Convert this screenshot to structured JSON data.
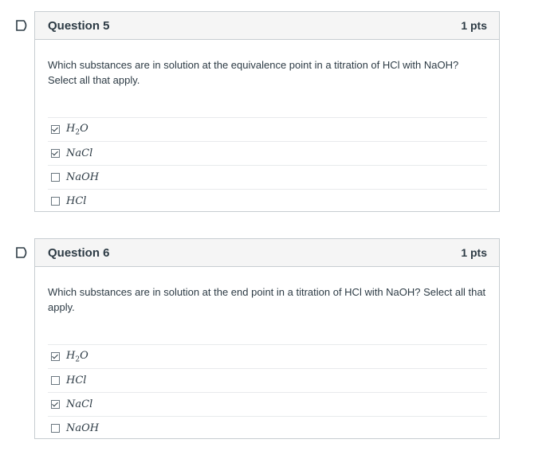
{
  "questions": [
    {
      "title": "Question 5",
      "points": "1 pts",
      "text": "Which substances are in solution at the equivalence point in a titration of HCl with NaOH?  Select all that apply.",
      "answers": [
        {
          "label": "H",
          "sub": "2",
          "tail": "O",
          "checked": true
        },
        {
          "label": "NaCl",
          "checked": true
        },
        {
          "label": "NaOH",
          "checked": false
        },
        {
          "label": "HCl",
          "checked": false
        }
      ]
    },
    {
      "title": "Question 6",
      "points": "1 pts",
      "text": "Which substances are in solution at the end point in a titration of HCl with NaOH?  Select all that apply.",
      "answers": [
        {
          "label": "H",
          "sub": "2",
          "tail": "O",
          "checked": true
        },
        {
          "label": "HCl",
          "checked": false
        },
        {
          "label": "NaCl",
          "checked": true
        },
        {
          "label": "NaOH",
          "checked": false
        }
      ]
    }
  ],
  "colors": {
    "flag": "#2d3b45",
    "border": "#c7cdd1",
    "header_bg": "#f5f5f5"
  },
  "icons": {
    "flag": "flag-icon"
  }
}
